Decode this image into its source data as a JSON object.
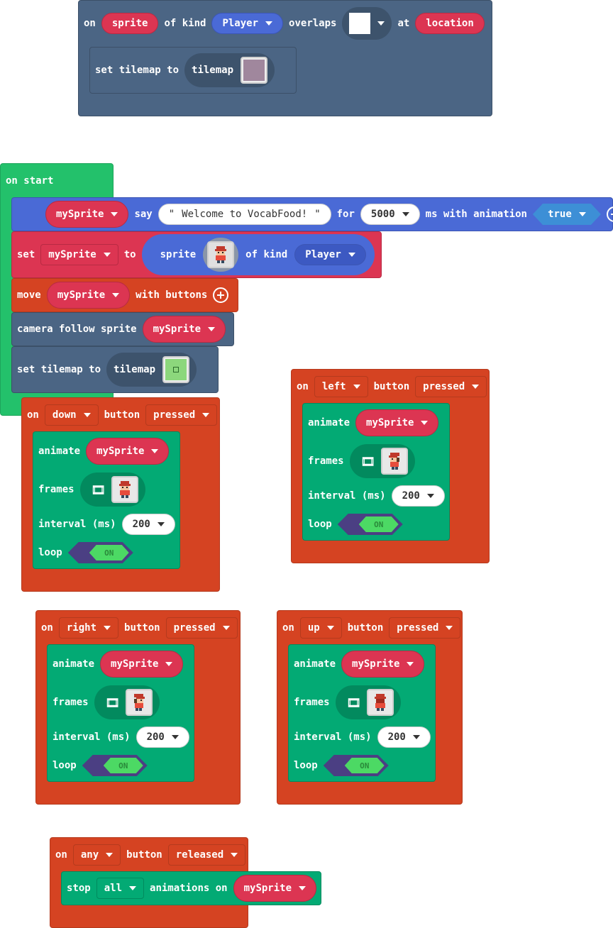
{
  "overlap_event": {
    "on": "on",
    "sprite": "sprite",
    "of_kind": "of kind",
    "kind": "Player",
    "overlaps": "overlaps",
    "at": "at",
    "location": "location",
    "set_tilemap": "set tilemap to",
    "tilemap": "tilemap"
  },
  "on_start": {
    "label": "on start",
    "say_var": "mySprite",
    "say": "say",
    "message": "Welcome to VocabFood!",
    "for": "for",
    "duration": "5000",
    "ms_with_animation": "ms with animation",
    "animation": "true",
    "set": "set",
    "set_var": "mySprite",
    "to": "to",
    "sprite": "sprite",
    "of_kind": "of kind",
    "kind": "Player",
    "move": "move",
    "move_var": "mySprite",
    "with_buttons": "with buttons",
    "camera_follow": "camera follow sprite",
    "camera_var": "mySprite",
    "set_tilemap": "set tilemap to",
    "tilemap": "tilemap"
  },
  "button_events": [
    {
      "id": "down",
      "on": "on",
      "button_name": "down",
      "button": "button",
      "action": "pressed",
      "animate": "animate",
      "var": "mySprite",
      "frames": "frames",
      "interval": "interval (ms)",
      "interval_value": "200",
      "loop": "loop",
      "loop_state": "ON"
    },
    {
      "id": "left",
      "on": "on",
      "button_name": "left",
      "button": "button",
      "action": "pressed",
      "animate": "animate",
      "var": "mySprite",
      "frames": "frames",
      "interval": "interval (ms)",
      "interval_value": "200",
      "loop": "loop",
      "loop_state": "ON"
    },
    {
      "id": "right",
      "on": "on",
      "button_name": "right",
      "button": "button",
      "action": "pressed",
      "animate": "animate",
      "var": "mySprite",
      "frames": "frames",
      "interval": "interval (ms)",
      "interval_value": "200",
      "loop": "loop",
      "loop_state": "ON"
    },
    {
      "id": "up",
      "on": "on",
      "button_name": "up",
      "button": "button",
      "action": "pressed",
      "animate": "animate",
      "var": "mySprite",
      "frames": "frames",
      "interval": "interval (ms)",
      "interval_value": "200",
      "loop": "loop",
      "loop_state": "ON"
    }
  ],
  "release_event": {
    "on": "on",
    "button_name": "any",
    "button": "button",
    "action": "released",
    "stop": "stop",
    "scope": "all",
    "animations_on": "animations on",
    "var": "mySprite"
  },
  "colors": {
    "scene_block": "#4b6584",
    "event_orange": "#d54322",
    "on_start_green": "#23c16b",
    "sprites_red": "#dc3552",
    "animation_teal": "#03aa74",
    "say_blue": "#4a6ad6",
    "controller_red": "#d54322",
    "toggle_purple": "#4b3f83",
    "toggle_green": "#4cd964"
  }
}
